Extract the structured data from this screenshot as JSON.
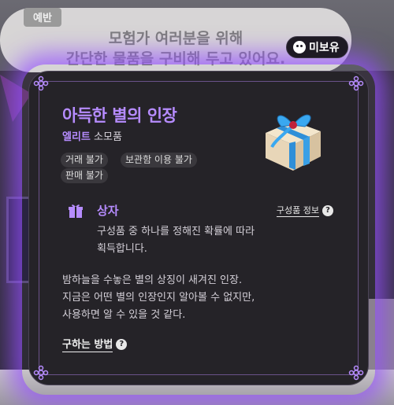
{
  "speech": {
    "speaker": "예반",
    "line1": "모험가 여러분을 위해",
    "line2": "간단한 물품을 구비해 두고 있어요."
  },
  "status_badge": {
    "icon": "face-icon",
    "label": "미보유"
  },
  "item": {
    "title": "아득한 별의 인장",
    "grade": "엘리트",
    "type": "소모품",
    "tags": [
      "거래 불가",
      "보관함 이용 불가",
      "판매 불가"
    ],
    "section": {
      "icon": "gift-box-icon",
      "title": "상자",
      "info_link": "구성품 정보",
      "description_line1": "구성품 중 하나를 정해진 확률에 따라",
      "description_line2": "획득합니다."
    },
    "flavor_line1": "밤하늘을 수놓은 별의 상징이 새겨진 인장.",
    "flavor_line2": "지금은 어떤 별의 인장인지 알아볼 수 없지만,",
    "flavor_line3": "사용하면 알 수 있을 것 같다.",
    "how_to_label": "구하는 방법"
  },
  "colors": {
    "accent": "#b68cff",
    "glow": "#9650ff",
    "card_bg": "#252328"
  }
}
